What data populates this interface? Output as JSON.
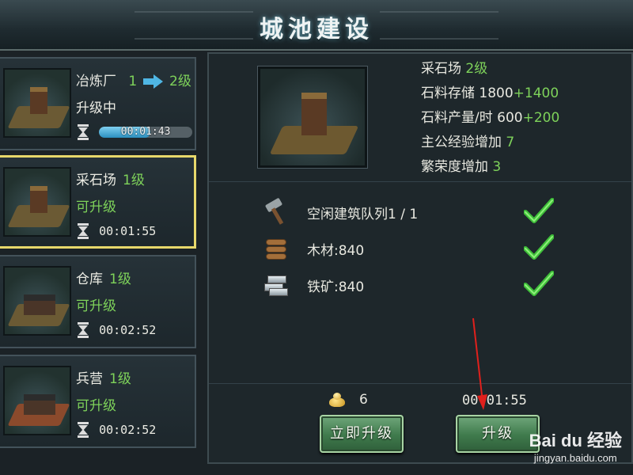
{
  "title": "城池建设",
  "buildings": [
    {
      "name": "冶炼厂",
      "from_level": "1",
      "to_level": "2级",
      "status": "升级中",
      "timer": "00:01:43",
      "progress": 0.55
    },
    {
      "name": "采石场",
      "level": "1级",
      "status": "可升级",
      "timer": "00:01:55"
    },
    {
      "name": "仓库",
      "level": "1级",
      "status": "可升级",
      "timer": "00:02:52"
    },
    {
      "name": "兵营",
      "level": "1级",
      "status": "可升级",
      "timer": "00:02:52"
    }
  ],
  "detail": {
    "name": "采石场",
    "level": "2级",
    "storage_label": "石料存储",
    "storage_value": "1800",
    "storage_plus": "+1400",
    "output_label": "石料产量/时",
    "output_value": "600",
    "output_plus": "+200",
    "exp_label": "主公经验增加",
    "exp_value": "7",
    "prosperity_label": "繁荣度增加",
    "prosperity_value": "3"
  },
  "requirements": [
    {
      "icon": "hammer-icon",
      "text": "空闲建筑队列1 / 1",
      "met": true
    },
    {
      "icon": "wood-icon",
      "text": "木材:840",
      "met": true
    },
    {
      "icon": "ore-icon",
      "text": "铁矿:840",
      "met": true
    }
  ],
  "cost": {
    "icon": "gold-ingot-icon",
    "value": "6"
  },
  "upgrade_time": "00:01:55",
  "buttons": {
    "instant_upgrade": "立即升级",
    "upgrade": "升级"
  },
  "watermark": {
    "logo": "Bai du 经验",
    "url": "jingyan.baidu.com"
  },
  "colors": {
    "green_text": "#7ed25a",
    "selected_border": "#e7d86b",
    "progress_blue": "#4fb6e4",
    "button_green": "#3f7a4c"
  }
}
